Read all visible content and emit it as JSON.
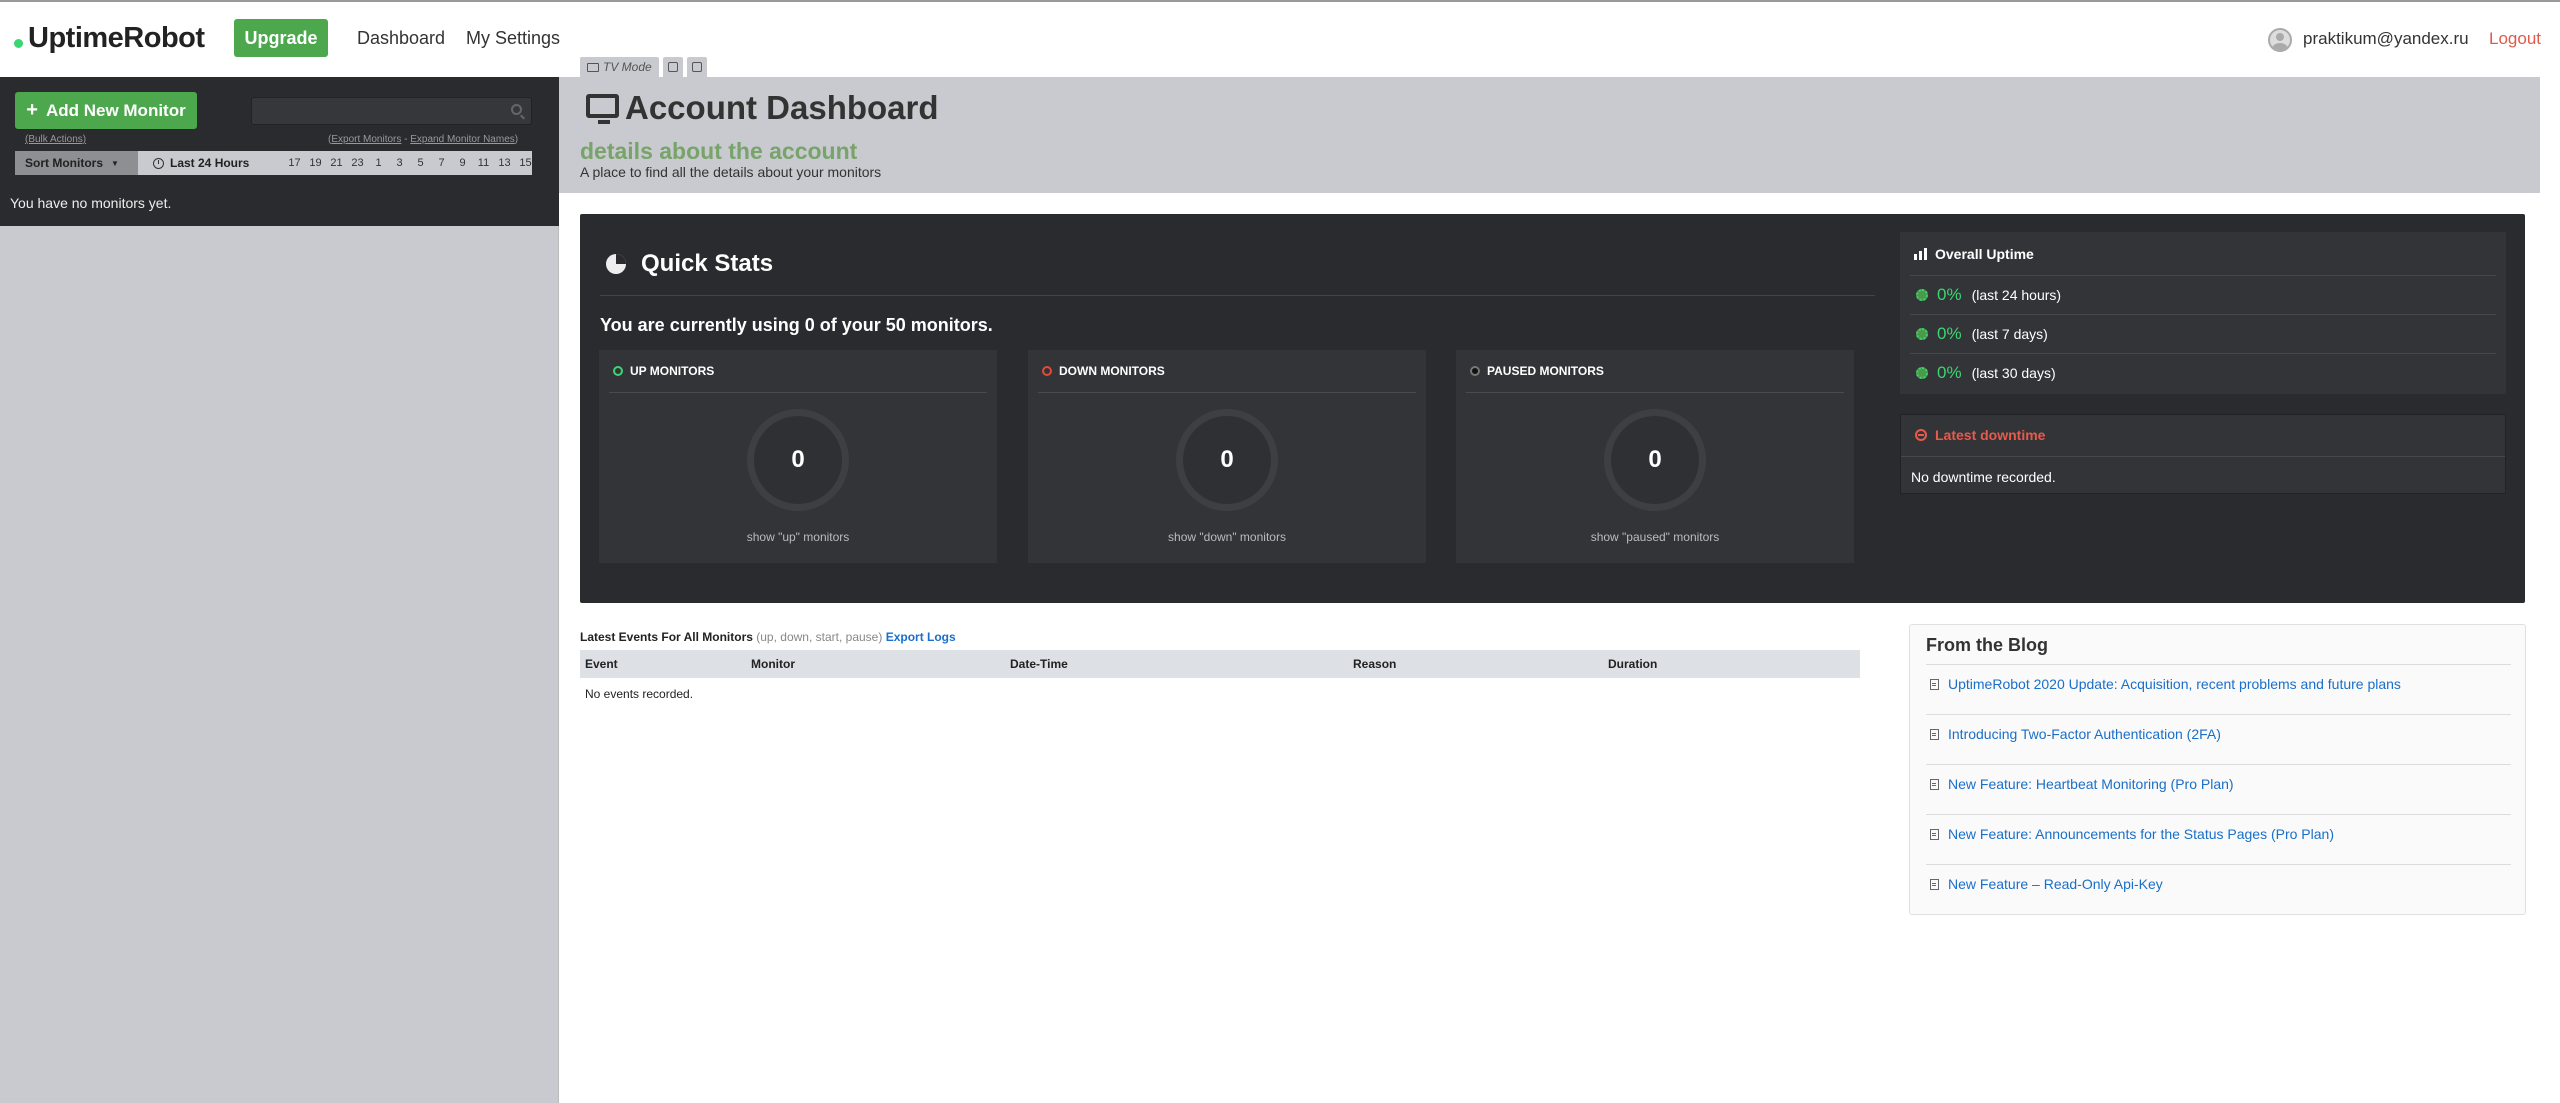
{
  "header": {
    "logo": "UptimeRobot",
    "upgrade_label": "Upgrade",
    "nav": {
      "dashboard": "Dashboard",
      "settings": "My Settings"
    },
    "user_email": "praktikum@yandex.ru",
    "logout_label": "Logout"
  },
  "sidebar": {
    "add_monitor_label": "Add New Monitor",
    "search_value": "",
    "bulk_actions": "(Bulk Actions)",
    "export_monitors": "Export Monitors",
    "expand_names": "Expand Monitor Names",
    "sort_label": "Sort Monitors",
    "period_label": "Last 24 Hours",
    "hours": [
      "17",
      "19",
      "21",
      "23",
      "1",
      "3",
      "5",
      "7",
      "9",
      "11",
      "13",
      "15"
    ],
    "empty_text": "You have no monitors yet."
  },
  "tabs": {
    "tv_mode": "TV Mode"
  },
  "dashboard": {
    "title": "Account Dashboard",
    "subtitle": "details about the account",
    "description": "A place to find all the details about your monitors"
  },
  "quick_stats": {
    "title": "Quick Stats",
    "usage": "You are currently using 0 of your 50 monitors.",
    "cards": {
      "up": {
        "label": "UP MONITORS",
        "count": "0",
        "link": "show \"up\" monitors"
      },
      "down": {
        "label": "DOWN MONITORS",
        "count": "0",
        "link": "show \"down\" monitors"
      },
      "paused": {
        "label": "PAUSED MONITORS",
        "count": "0",
        "link": "show \"paused\" monitors"
      }
    },
    "overall_uptime": {
      "title": "Overall Uptime",
      "rows": [
        {
          "pct": "0%",
          "period": "(last 24 hours)"
        },
        {
          "pct": "0%",
          "period": "(last 7 days)"
        },
        {
          "pct": "0%",
          "period": "(last 30 days)"
        }
      ]
    },
    "latest_downtime": {
      "title": "Latest downtime",
      "text": "No downtime recorded."
    }
  },
  "events": {
    "title": "Latest Events For All Monitors",
    "hint": "(up, down, start, pause)",
    "export_label": "Export Logs",
    "columns": [
      "Event",
      "Monitor",
      "Date-Time",
      "Reason",
      "Duration"
    ],
    "empty_text": "No events recorded."
  },
  "blog": {
    "title": "From the Blog",
    "items": [
      "UptimeRobot 2020 Update: Acquisition, recent problems and future plans",
      "Introducing Two-Factor Authentication (2FA)",
      "New Feature: Heartbeat Monitoring (Pro Plan)",
      "New Feature: Announcements for the Status Pages (Pro Plan)",
      "New Feature – Read-Only Api-Key"
    ]
  },
  "colors": {
    "brand_green": "#4da74d",
    "up_green": "#3bd671",
    "down_red": "#e34a3a",
    "link_blue": "#1a6fc9"
  }
}
